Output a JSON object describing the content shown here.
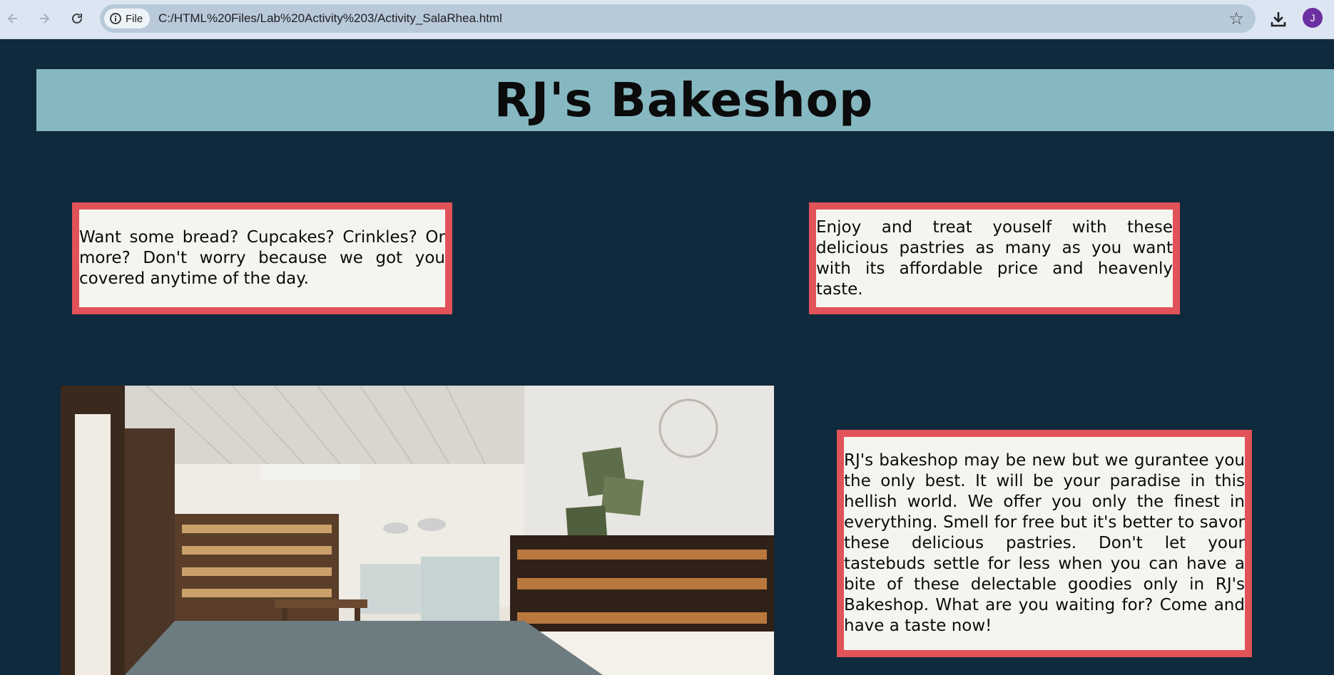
{
  "browser": {
    "chip_label": "File",
    "url": "C:/HTML%20Files/Lab%20Activity%203/Activity_SalaRhea.html",
    "avatar_initial": "J",
    "icons": [
      "back-arrow-icon",
      "forward-arrow-icon",
      "reload-icon",
      "info-icon",
      "star-icon",
      "download-icon"
    ]
  },
  "page": {
    "title": "RJ's Bakeshop",
    "card1_text": "Want some bread? Cupcakes? Crinkles? Or more? Don't worry because we got you covered anytime of the day.",
    "card2_text": "Enjoy and treat youself with these delicious pastries as many as you want with its affordable price and heavenly taste.",
    "card3_text": "RJ's bakeshop may be new but we gurantee you the only best. It will be your paradise in this hellish world. We offer you only the finest in everything. Smell for free but it's better to savor these delicious pastries. Don't let your tastebuds settle for less when you can have a bite of these delectable goodies only in RJ's Bakeshop. What are you waiting for? Come and have a taste now!"
  },
  "colors": {
    "page_background": "#0f2a3c",
    "banner": "#86b8c2",
    "card_border": "#e25259",
    "card_background": "#f5f5f0"
  }
}
